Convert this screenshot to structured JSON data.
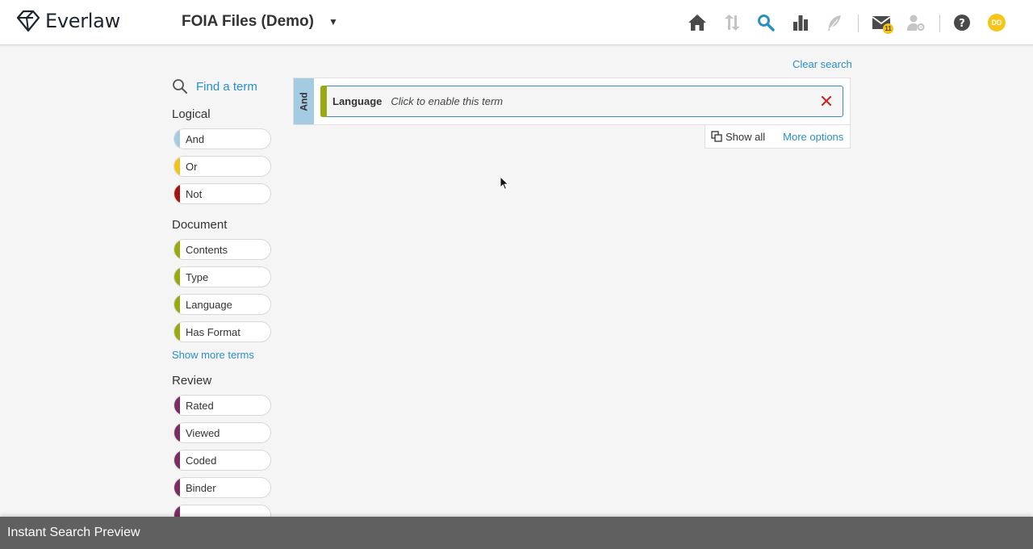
{
  "header": {
    "logo_text": "Everlaw",
    "project_name": "FOIA Files (Demo)",
    "message_count": "11",
    "avatar_initials": "DD"
  },
  "sidebar": {
    "find_term": "Find a term",
    "sections": [
      {
        "title": "Logical",
        "terms": [
          {
            "label": "And",
            "color": "#a5cbe2"
          },
          {
            "label": "Or",
            "color": "#f3c21b"
          },
          {
            "label": "Not",
            "color": "#a8130f"
          }
        ]
      },
      {
        "title": "Document",
        "terms": [
          {
            "label": "Contents",
            "color": "#99a90f"
          },
          {
            "label": "Type",
            "color": "#99a90f"
          },
          {
            "label": "Language",
            "color": "#99a90f"
          },
          {
            "label": "Has Format",
            "color": "#99a90f"
          }
        ],
        "show_more": "Show more terms"
      },
      {
        "title": "Review",
        "terms": [
          {
            "label": "Rated",
            "color": "#7b2d5f"
          },
          {
            "label": "Viewed",
            "color": "#7b2d5f"
          },
          {
            "label": "Coded",
            "color": "#7b2d5f"
          },
          {
            "label": "Binder",
            "color": "#7b2d5f"
          }
        ]
      }
    ]
  },
  "search": {
    "clear_label": "Clear search",
    "group_label": "And",
    "term_name": "Language",
    "term_hint": "Click to enable this term",
    "show_all_label": "Show all",
    "more_options_label": "More options"
  },
  "bottom_bar": {
    "label": "Instant Search Preview"
  }
}
